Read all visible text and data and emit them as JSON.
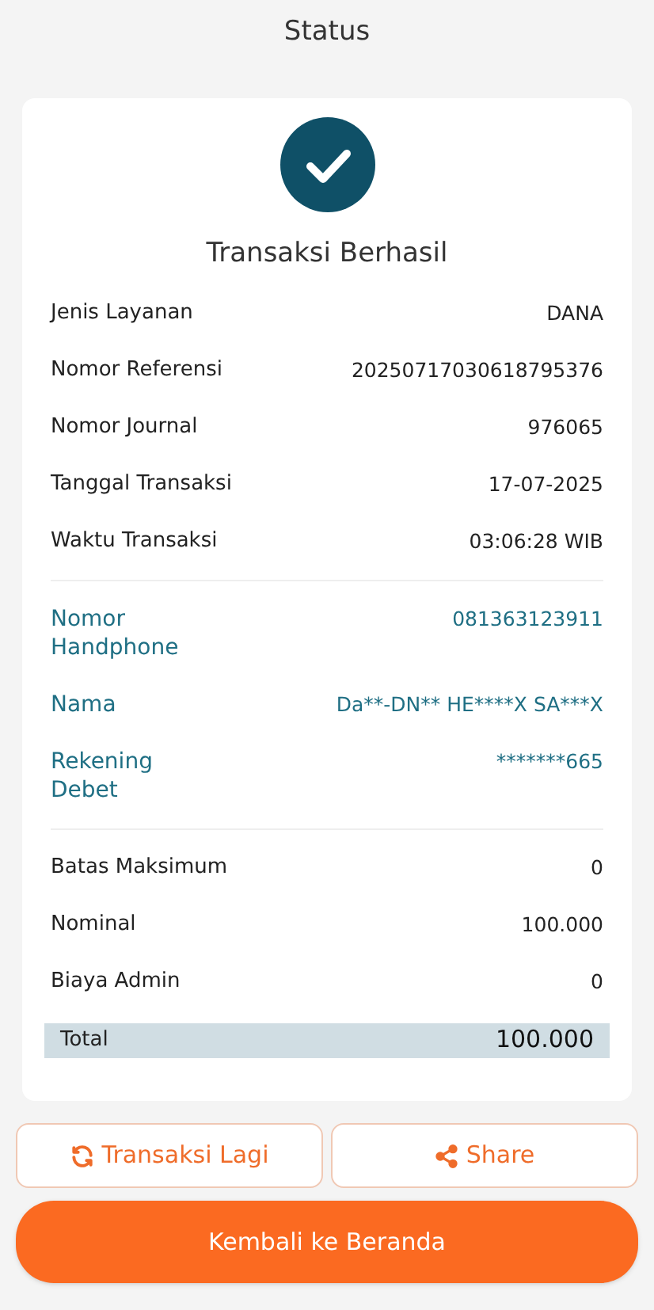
{
  "header": {
    "title": "Status"
  },
  "result": {
    "title": "Transaksi Berhasil"
  },
  "sections": [
    {
      "kind": "plain",
      "rows": [
        {
          "label": "Jenis Layanan",
          "value": "DANA"
        },
        {
          "label": "Nomor Referensi",
          "value": "20250717030618795376"
        },
        {
          "label": "Nomor Journal",
          "value": "976065"
        },
        {
          "label": "Tanggal Transaksi",
          "value": "17-07-2025"
        },
        {
          "label": "Waktu Transaksi",
          "value": "03:06:28 WIB"
        }
      ]
    },
    {
      "kind": "highlight",
      "rows": [
        {
          "label": "Nomor Handphone",
          "value": "081363123911"
        },
        {
          "label": "Nama",
          "value": "Da**-DN** HE****X SA***X"
        },
        {
          "label": "Rekening Debet",
          "value": "*******665"
        }
      ]
    },
    {
      "kind": "plain",
      "rows": [
        {
          "label": "Batas Maksimum",
          "value": "0"
        },
        {
          "label": "Nominal",
          "value": "100.000"
        },
        {
          "label": "Biaya Admin",
          "value": "0"
        }
      ]
    }
  ],
  "total": {
    "label": "Total",
    "value": "100.000"
  },
  "actions": [
    {
      "kind": "repeat",
      "label": "Transaksi Lagi"
    },
    {
      "kind": "share",
      "label": "Share"
    }
  ],
  "primary_button": "Kembali ke Beranda"
}
